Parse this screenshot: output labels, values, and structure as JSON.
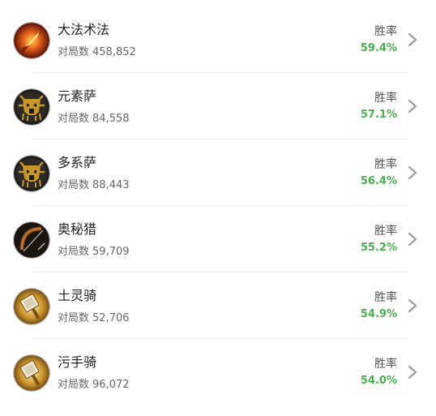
{
  "games_label": "对局数",
  "winrate_label": "胜率",
  "accent_green": "#4caf50",
  "items": [
    {
      "name": "大法术法",
      "games": "458,852",
      "winrate": "59.4%",
      "icon": "fire-spell-icon"
    },
    {
      "name": "元素萨",
      "games": "84,558",
      "winrate": "57.1%",
      "icon": "totem-icon"
    },
    {
      "name": "多系萨",
      "games": "88,443",
      "winrate": "56.4%",
      "icon": "totem-icon"
    },
    {
      "name": "奥秘猎",
      "games": "59,709",
      "winrate": "55.2%",
      "icon": "bow-icon"
    },
    {
      "name": "土灵骑",
      "games": "52,706",
      "winrate": "54.9%",
      "icon": "hammer-icon"
    },
    {
      "name": "污手骑",
      "games": "96,072",
      "winrate": "54.0%",
      "icon": "hammer-icon"
    }
  ]
}
